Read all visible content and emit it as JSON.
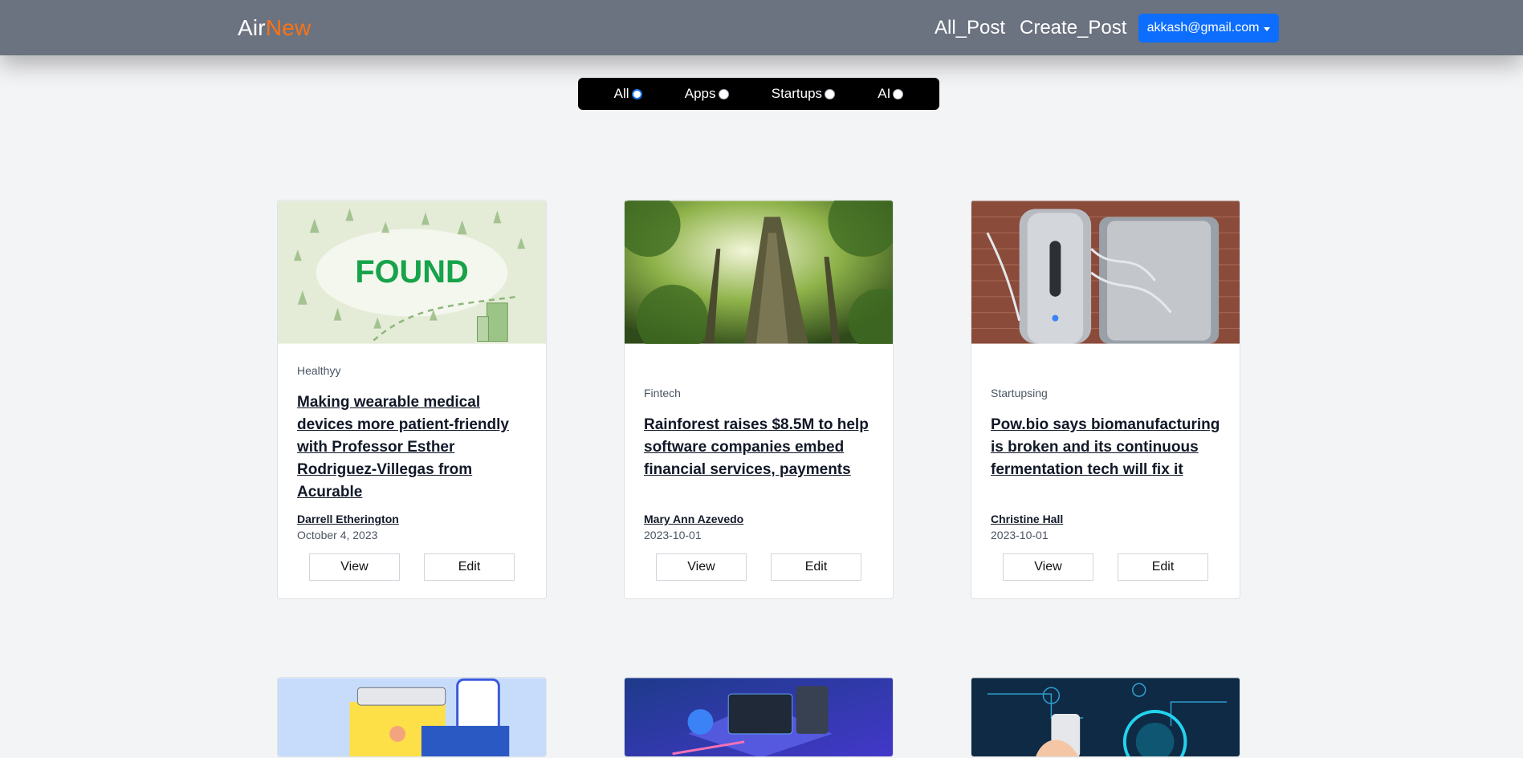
{
  "navbar": {
    "brand_main": "Air",
    "brand_accent": "New",
    "links": [
      "All_Post",
      "Create_Post"
    ],
    "user_email": "akkash@gmail.com",
    "bg_color": "#6b7280",
    "accent_color": "#f97316"
  },
  "filters": {
    "selected": "All",
    "options": [
      "All",
      "Apps",
      "Startups",
      "AI"
    ]
  },
  "posts": [
    {
      "category": "Healthyy",
      "title": "Making wearable medical devices more patient-friendly with Professor Esther Rodriguez-Villegas from Acurable",
      "author": "Darrell Etherington",
      "date": "October 4, 2023",
      "image_text": "FOUND",
      "view_label": "View",
      "edit_label": "Edit"
    },
    {
      "category": "Fintech",
      "title": "Rainforest raises $8.5M to help software companies embed financial services, payments",
      "author": "Mary Ann Azevedo",
      "date": "2023-10-01",
      "view_label": "View",
      "edit_label": "Edit"
    },
    {
      "category": "Startupsing",
      "title": "Pow.bio says biomanufacturing is broken and its continuous fermentation tech will fix it",
      "author": "Christine Hall",
      "date": "2023-10-01",
      "view_label": "View",
      "edit_label": "Edit"
    }
  ],
  "second_row_images": [
    "small-business-illustration",
    "computer-setup-illustration",
    "ai-tech-hand-illustration"
  ]
}
